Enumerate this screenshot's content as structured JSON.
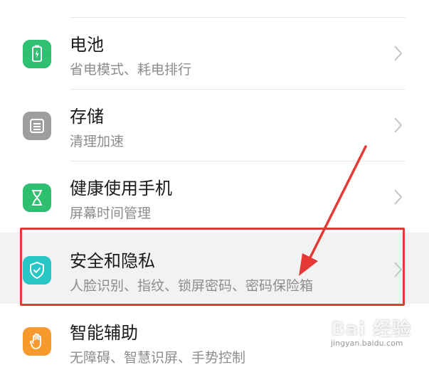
{
  "settings_items": [
    {
      "title": "电池",
      "subtitle": "省电模式、耗电排行",
      "icon": "battery-icon",
      "icon_color": "#2fbf71"
    },
    {
      "title": "存储",
      "subtitle": "清理加速",
      "icon": "storage-icon",
      "icon_color": "#9e9e9e"
    },
    {
      "title": "健康使用手机",
      "subtitle": "屏幕时间管理",
      "icon": "hourglass-icon",
      "icon_color": "#2fbf71"
    },
    {
      "title": "安全和隐私",
      "subtitle": "人脸识别、指纹、锁屏密码、密码保险箱",
      "icon": "shield-icon",
      "icon_color": "#26c6c6"
    },
    {
      "title": "智能辅助",
      "subtitle": "无障碍、智慧识屏、手势控制",
      "icon": "hand-icon",
      "icon_color": "#f79a2d"
    }
  ],
  "watermark": {
    "brand": "Bai 经验",
    "url": "jingyan.baidu.com"
  },
  "annotation_color": "#e53935"
}
